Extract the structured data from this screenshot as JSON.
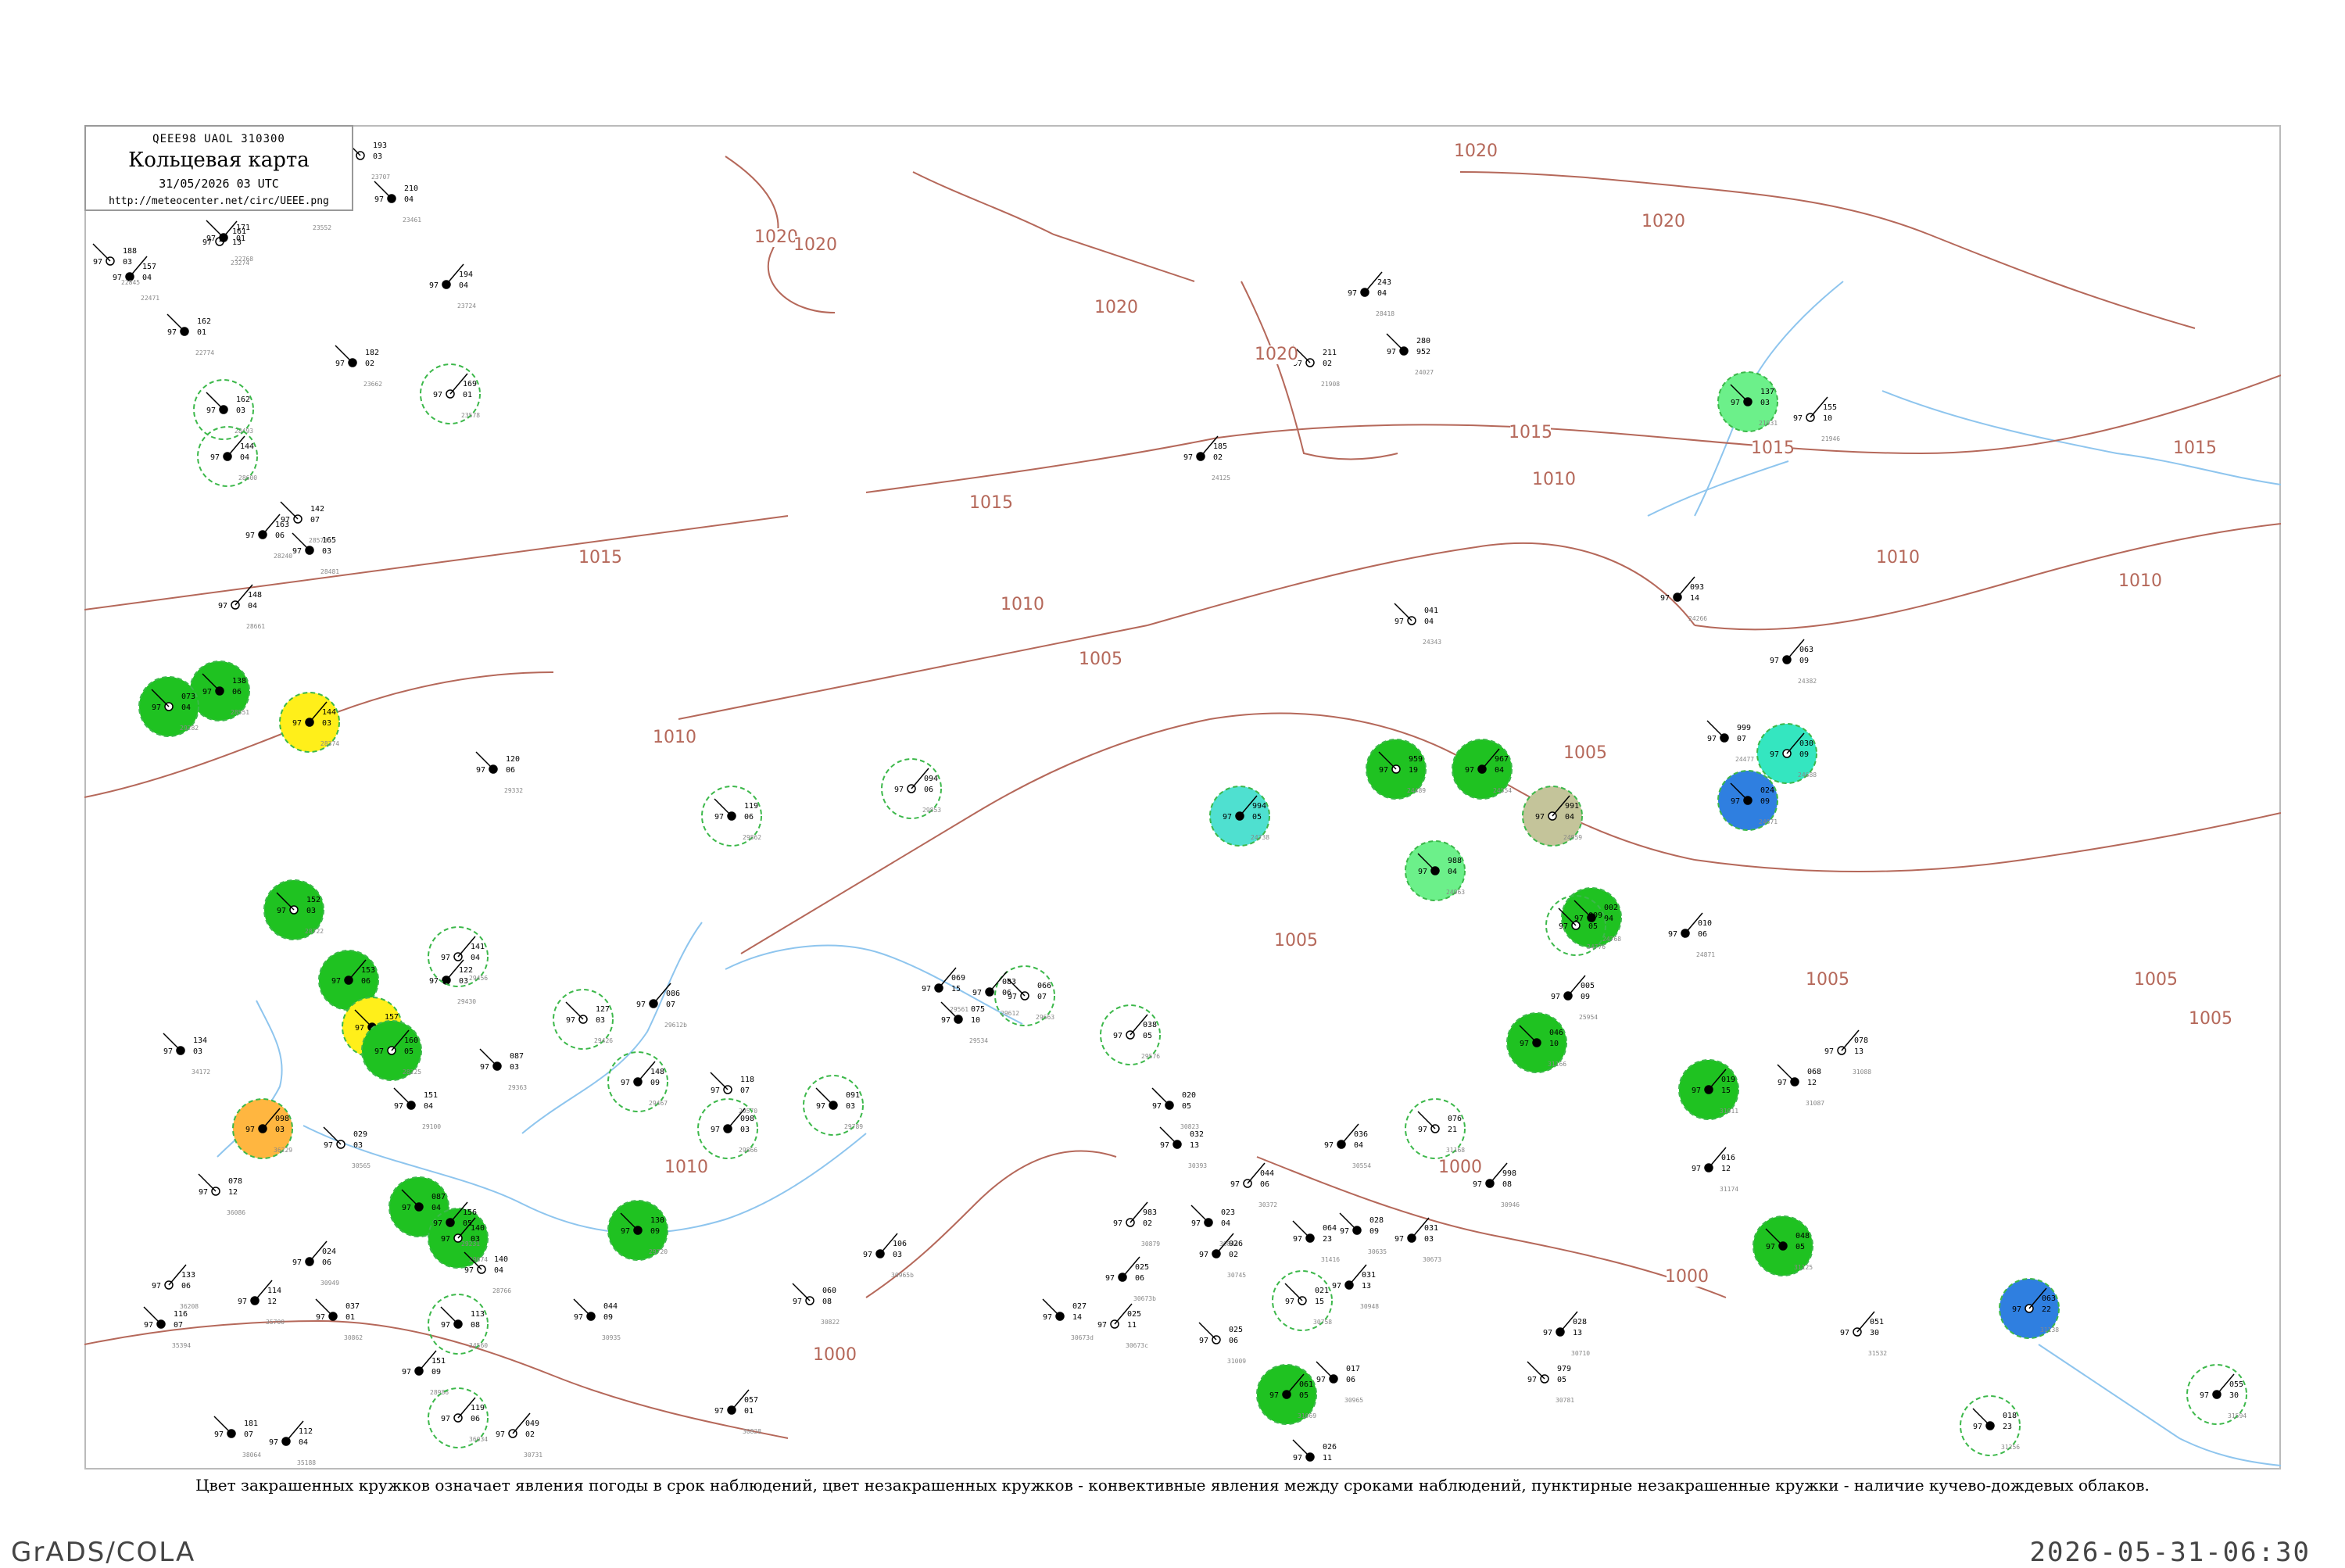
{
  "header": {
    "code": "QEEE98  UAOL  310300",
    "title": "Кольцевая карта",
    "date": "31/05/2026 03 UTC",
    "url": "http://meteocenter.net/circ/UEEE.png"
  },
  "isobar_labels": [
    "1020",
    "1020",
    "1020",
    "1020",
    "1020",
    "1020",
    "1015",
    "1015",
    "1015",
    "1015",
    "1015",
    "1010",
    "1010",
    "1010",
    "1010",
    "1010",
    "1010",
    "1005",
    "1005",
    "1005",
    "1005",
    "1005",
    "1005",
    "1000",
    "1000",
    "1000"
  ],
  "colors": {
    "isobar": "#b5685a",
    "river": "#8ec5ee",
    "ring": "#3cb84a",
    "green": "#1fc221",
    "light_green": "#6cf08a",
    "blue": "#2f7fe0",
    "cyan": "#34e6c0",
    "aqua": "#4fe0d0",
    "yellow": "#ffef1a",
    "orange": "#ffb640",
    "khaki": "#c4c49a"
  },
  "stations": [
    {
      "id": "23707",
      "t": "97",
      "p": "193",
      "v": "03"
    },
    {
      "id": "23552",
      "t": "97",
      "p": "202",
      "v": "06"
    },
    {
      "id": "23461",
      "t": "97",
      "p": "210",
      "v": "04"
    },
    {
      "id": "23274",
      "t": "97",
      "p": "161",
      "v": "13"
    },
    {
      "id": "22768",
      "t": "97",
      "p": "171",
      "v": "01"
    },
    {
      "id": "22471",
      "t": "97",
      "p": "157",
      "v": "04"
    },
    {
      "id": "22845",
      "t": "97",
      "p": "188",
      "v": "03"
    },
    {
      "id": "23724",
      "t": "97",
      "p": "194",
      "v": "04"
    },
    {
      "id": "23662",
      "t": "97",
      "p": "182",
      "v": "02"
    },
    {
      "id": "23578",
      "t": "97",
      "p": "169",
      "v": "01"
    },
    {
      "id": "22774",
      "t": "97",
      "p": "162",
      "v": "01"
    },
    {
      "id": "28418",
      "t": "97",
      "p": "243",
      "v": "04"
    },
    {
      "id": "21908",
      "t": "97",
      "p": "211",
      "v": "02"
    },
    {
      "id": "24125",
      "t": "97",
      "p": "185",
      "v": "02"
    },
    {
      "id": "24027",
      "t": "97",
      "p": "280",
      "v": "952"
    },
    {
      "id": "21946",
      "t": "97",
      "p": "155",
      "v": "10"
    },
    {
      "id": "21931",
      "t": "97",
      "p": "137",
      "v": "03"
    },
    {
      "id": "24266",
      "t": "97",
      "p": "093",
      "v": "14"
    },
    {
      "id": "24343",
      "t": "97",
      "p": "041",
      "v": "04"
    },
    {
      "id": "24382",
      "t": "97",
      "p": "063",
      "v": "09"
    },
    {
      "id": "24477",
      "t": "97",
      "p": "999",
      "v": "07"
    },
    {
      "id": "24688",
      "t": "97",
      "p": "030",
      "v": "09"
    },
    {
      "id": "24671",
      "t": "97",
      "p": "024",
      "v": "09"
    },
    {
      "id": "24738",
      "t": "97",
      "p": "994",
      "v": "05"
    },
    {
      "id": "24489",
      "t": "97",
      "p": "959",
      "v": "19"
    },
    {
      "id": "24554",
      "t": "97",
      "p": "967",
      "v": "04"
    },
    {
      "id": "24963",
      "t": "97",
      "p": "988",
      "v": "04"
    },
    {
      "id": "24959",
      "t": "97",
      "p": "991",
      "v": "04"
    },
    {
      "id": "24768",
      "t": "97",
      "p": "002",
      "v": "04"
    },
    {
      "id": "24871",
      "t": "97",
      "p": "010",
      "v": "06"
    },
    {
      "id": "24776",
      "t": "97",
      "p": "009",
      "v": "05"
    },
    {
      "id": "25954",
      "t": "97",
      "p": "005",
      "v": "09"
    },
    {
      "id": "31166",
      "t": "97",
      "p": "046",
      "v": "10"
    },
    {
      "id": "31088",
      "t": "97",
      "p": "078",
      "v": "13"
    },
    {
      "id": "31087",
      "t": "97",
      "p": "068",
      "v": "12"
    },
    {
      "id": "31011",
      "t": "97",
      "p": "019",
      "v": "15"
    },
    {
      "id": "31168",
      "t": "97",
      "p": "076",
      "v": "21"
    },
    {
      "id": "31174",
      "t": "97",
      "p": "016",
      "v": "12"
    },
    {
      "id": "31416",
      "t": "97",
      "p": "064",
      "v": "23"
    },
    {
      "id": "31532",
      "t": "97",
      "p": "051",
      "v": "30"
    },
    {
      "id": "30823",
      "t": "97",
      "p": "020",
      "v": "05"
    },
    {
      "id": "30946",
      "t": "97",
      "p": "998",
      "v": "08"
    },
    {
      "id": "31009",
      "t": "97",
      "p": "025",
      "v": "06"
    },
    {
      "id": "30554",
      "t": "97",
      "p": "036",
      "v": "04"
    },
    {
      "id": "30393",
      "t": "97",
      "p": "032",
      "v": "13"
    },
    {
      "id": "30372",
      "t": "97",
      "p": "044",
      "v": "06"
    },
    {
      "id": "30635",
      "t": "97",
      "p": "028",
      "v": "09"
    },
    {
      "id": "30673",
      "t": "97",
      "p": "031",
      "v": "03"
    },
    {
      "id": "30781",
      "t": "97",
      "p": "979",
      "v": "05"
    },
    {
      "id": "30710",
      "t": "97",
      "p": "028",
      "v": "13"
    },
    {
      "id": "30965",
      "t": "97",
      "p": "017",
      "v": "06"
    },
    {
      "id": "29853",
      "t": "97",
      "p": "094",
      "v": "06"
    },
    {
      "id": "29862",
      "t": "97",
      "p": "119",
      "v": "06"
    },
    {
      "id": "29561",
      "t": "97",
      "p": "069",
      "v": "15"
    },
    {
      "id": "29663",
      "t": "97",
      "p": "066",
      "v": "07"
    },
    {
      "id": "29612",
      "t": "97",
      "p": "083",
      "v": "06"
    },
    {
      "id": "29534",
      "t": "97",
      "p": "075",
      "v": "10"
    },
    {
      "id": "29576",
      "t": "97",
      "p": "038",
      "v": "05"
    },
    {
      "id": "29789",
      "t": "97",
      "p": "091",
      "v": "03"
    },
    {
      "id": "29612b",
      "t": "97",
      "p": "086",
      "v": "07"
    },
    {
      "id": "29426",
      "t": "97",
      "p": "127",
      "v": "03"
    },
    {
      "id": "29430",
      "t": "97",
      "p": "122",
      "v": "03"
    },
    {
      "id": "29332",
      "t": "97",
      "p": "120",
      "v": "06"
    },
    {
      "id": "29456",
      "t": "97",
      "p": "141",
      "v": "04"
    },
    {
      "id": "29363",
      "t": "97",
      "p": "087",
      "v": "03"
    },
    {
      "id": "29467",
      "t": "97",
      "p": "148",
      "v": "09"
    },
    {
      "id": "29570",
      "t": "97",
      "p": "118",
      "v": "07"
    },
    {
      "id": "29866",
      "t": "97",
      "p": "098",
      "v": "03"
    },
    {
      "id": "29828",
      "t": "97",
      "p": "087",
      "v": "04"
    },
    {
      "id": "29674",
      "t": "97",
      "p": "140",
      "v": "03"
    },
    {
      "id": "29720",
      "t": "97",
      "p": "130",
      "v": "09"
    },
    {
      "id": "30965b",
      "t": "97",
      "p": "106",
      "v": "03"
    },
    {
      "id": "30822",
      "t": "97",
      "p": "060",
      "v": "08"
    },
    {
      "id": "30828",
      "t": "97",
      "p": "057",
      "v": "01"
    },
    {
      "id": "30935",
      "t": "97",
      "p": "044",
      "v": "09"
    },
    {
      "id": "30731",
      "t": "97",
      "p": "049",
      "v": "02"
    },
    {
      "id": "30862",
      "t": "97",
      "p": "037",
      "v": "01"
    },
    {
      "id": "30949",
      "t": "97",
      "p": "024",
      "v": "06"
    },
    {
      "id": "30565",
      "t": "97",
      "p": "029",
      "v": "03"
    },
    {
      "id": "30673b",
      "t": "97",
      "p": "025",
      "v": "06"
    },
    {
      "id": "30844",
      "t": "97",
      "p": "023",
      "v": "04"
    },
    {
      "id": "30673c",
      "t": "97",
      "p": "025",
      "v": "11"
    },
    {
      "id": "30673d",
      "t": "97",
      "p": "027",
      "v": "14"
    },
    {
      "id": "30745",
      "t": "97",
      "p": "026",
      "v": "02"
    },
    {
      "id": "30758",
      "t": "97",
      "p": "021",
      "v": "15"
    },
    {
      "id": "30948",
      "t": "97",
      "p": "031",
      "v": "13"
    },
    {
      "id": "30554b",
      "t": "97",
      "p": "026",
      "v": "11"
    },
    {
      "id": "30879",
      "t": "97",
      "p": "983",
      "v": "02"
    },
    {
      "id": "28493",
      "t": "97",
      "p": "162",
      "v": "03"
    },
    {
      "id": "28600",
      "t": "97",
      "p": "144",
      "v": "04"
    },
    {
      "id": "28573",
      "t": "97",
      "p": "142",
      "v": "07"
    },
    {
      "id": "28240",
      "t": "97",
      "p": "163",
      "v": "06"
    },
    {
      "id": "28481",
      "t": "97",
      "p": "165",
      "v": "03"
    },
    {
      "id": "28661",
      "t": "97",
      "p": "148",
      "v": "04"
    },
    {
      "id": "28551",
      "t": "97",
      "p": "138",
      "v": "06"
    },
    {
      "id": "28374",
      "t": "97",
      "p": "144",
      "v": "03"
    },
    {
      "id": "28722",
      "t": "97",
      "p": "152",
      "v": "03"
    },
    {
      "id": "28434",
      "t": "97",
      "p": "153",
      "v": "06"
    },
    {
      "id": "28588",
      "t": "97",
      "p": "157",
      "v": "10"
    },
    {
      "id": "28225",
      "t": "97",
      "p": "160",
      "v": "05"
    },
    {
      "id": "29100",
      "t": "97",
      "p": "151",
      "v": "04"
    },
    {
      "id": "29231",
      "t": "97",
      "p": "156",
      "v": "05"
    },
    {
      "id": "28766",
      "t": "97",
      "p": "140",
      "v": "04"
    },
    {
      "id": "28986",
      "t": "97",
      "p": "151",
      "v": "09"
    },
    {
      "id": "34560",
      "t": "97",
      "p": "113",
      "v": "08"
    },
    {
      "id": "36034",
      "t": "97",
      "p": "119",
      "v": "06"
    },
    {
      "id": "35394",
      "t": "97",
      "p": "116",
      "v": "07"
    },
    {
      "id": "35700",
      "t": "97",
      "p": "114",
      "v": "12"
    },
    {
      "id": "36086",
      "t": "97",
      "p": "078",
      "v": "12"
    },
    {
      "id": "36229",
      "t": "97",
      "p": "098",
      "v": "03"
    },
    {
      "id": "38064",
      "t": "97",
      "p": "181",
      "v": "07"
    },
    {
      "id": "36208",
      "t": "97",
      "p": "133",
      "v": "06"
    },
    {
      "id": "34172",
      "t": "97",
      "p": "134",
      "v": "03"
    },
    {
      "id": "35188",
      "t": "97",
      "p": "112",
      "v": "04"
    },
    {
      "id": "29282",
      "t": "97",
      "p": "073",
      "v": "04"
    },
    {
      "id": "31069",
      "t": "97",
      "p": "061",
      "v": "05"
    },
    {
      "id": "31125",
      "t": "97",
      "p": "048",
      "v": "05"
    },
    {
      "id": "31138",
      "t": "97",
      "p": "063",
      "v": "22"
    },
    {
      "id": "31256",
      "t": "97",
      "p": "018",
      "v": "23"
    },
    {
      "id": "31594",
      "t": "97",
      "p": "055",
      "v": "30"
    }
  ],
  "caption": "Цвет закрашенных кружков означает явления погоды в срок наблюдений, цвет незакрашенных кружков - конвективные явления между сроками наблюдений, пунктирные незакрашенные кружки - наличие кучево-дождевых облаков.",
  "footer": {
    "left": "GrADS/COLA",
    "right": "2026-05-31-06:30"
  }
}
